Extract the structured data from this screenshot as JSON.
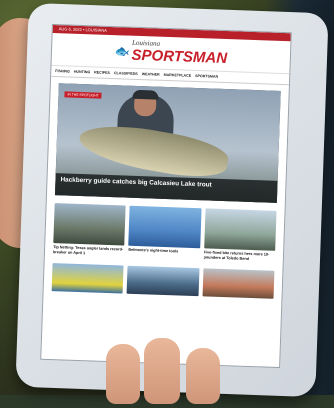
{
  "site": {
    "topbar_text": "AUG 6, 2022  •  LOUISIANA",
    "logo_small": "Louisiana",
    "logo_big": "SPORTSMAN"
  },
  "nav": [
    "FISHING",
    "HUNTING",
    "RECIPES",
    "CLASSIFIEDS",
    "WEATHER",
    "MARKETPLACE",
    "SPORTSMAN"
  ],
  "hero": {
    "tag": "IN THE SPOTLIGHT",
    "caption": "Hackberry guide catches big Calcasieu Lake trout"
  },
  "articles": [
    {
      "title": "Tip Netting: Texas angler lands record-breaker on April 1"
    },
    {
      "title": "Belmonte's night-time tools"
    },
    {
      "title": "Five-fixed bite returns hers more 10-pounders at Toledo Bend"
    }
  ],
  "colors": {
    "brand_red": "#c8202a",
    "strap_green": "#a3c93a"
  }
}
